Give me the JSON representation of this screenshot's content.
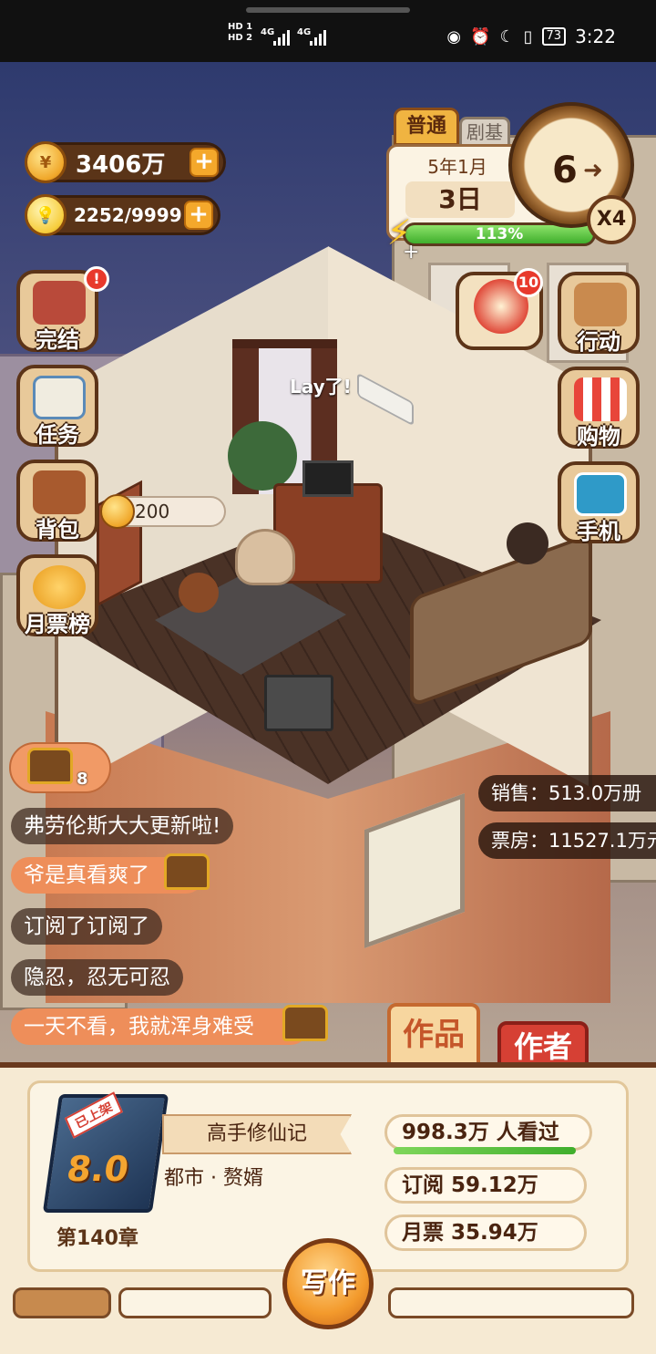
{
  "status_bar": {
    "net_label_1": "HD 1",
    "net_label_2": "HD 2",
    "sig1": "4G",
    "sig2": "4G",
    "battery": "73",
    "time": "3:22"
  },
  "resources": {
    "gold": "3406万",
    "inspiration": "2252/9999"
  },
  "calendar": {
    "mode_tab": "普通",
    "second_tab": "剧基",
    "year_month": "5年1月",
    "day": "3日",
    "energy_text": "113%",
    "energy_fill_fraction": 1.0,
    "dial_number": "6",
    "speed": "X4"
  },
  "left_menu": [
    {
      "label": "完结",
      "badge": "!"
    },
    {
      "label": "任务",
      "badge": ""
    },
    {
      "label": "背包",
      "badge": ""
    },
    {
      "label": "月票榜",
      "badge": ""
    }
  ],
  "right_menu": [
    {
      "label": "",
      "badge": "10"
    },
    {
      "label": "行动",
      "badge": ""
    },
    {
      "label": "购物",
      "badge": "",
      "sign": "SHOP"
    },
    {
      "label": "手机",
      "badge": ""
    }
  ],
  "scene": {
    "coin_chip": "200",
    "speech": "Lay了!"
  },
  "stats": {
    "sales": "销售：513.0万册",
    "box_office": "票房：11527.1万元"
  },
  "comments": {
    "chest_count": "8",
    "items": [
      "弗劳伦斯大大更新啦!",
      "爷是真看爽了",
      "订阅了订阅了",
      "隐忍，忍无可忍",
      "一天不看，我就浑身难受"
    ]
  },
  "tabs": {
    "works": "作品",
    "author": "作者"
  },
  "book": {
    "status_tag": "已上架",
    "score": "8.0",
    "chapter": "第140章",
    "title": "高手修仙记",
    "genre": "都市 · 赘婿",
    "views": "998.3万 人看过",
    "subscriptions": "订阅  59.12万",
    "monthly_votes": "月票  35.94万"
  },
  "write_button": "写作",
  "colors": {
    "accent": "#f39a2c",
    "brand_red": "#d64034",
    "energy_green": "#3fae2c"
  }
}
